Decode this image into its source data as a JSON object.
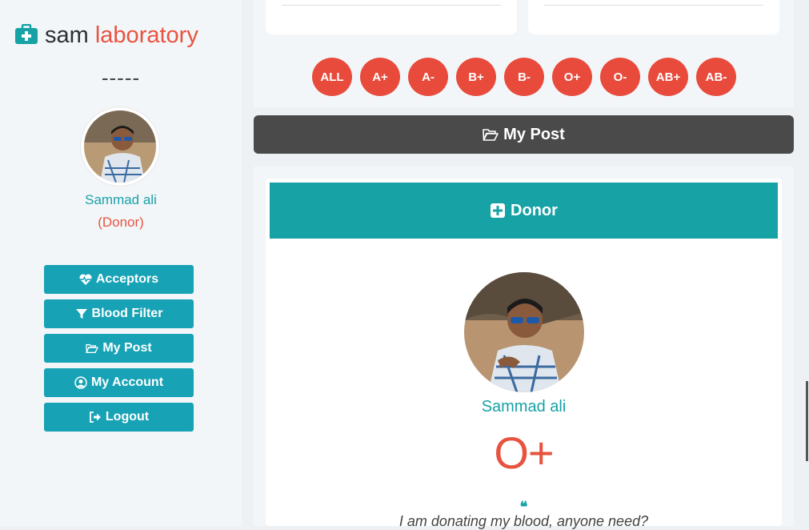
{
  "brand": {
    "word1": "sam",
    "word2": "laboratory",
    "icon": "medkit-icon"
  },
  "sidebar": {
    "separator": "-----",
    "user_name": "Sammad ali",
    "user_role": "(Donor)",
    "menu": [
      {
        "label": "Acceptors",
        "icon": "heartbeat-icon"
      },
      {
        "label": "Blood Filter",
        "icon": "filter-icon"
      },
      {
        "label": "My Post",
        "icon": "folder-open-icon"
      },
      {
        "label": "My Account",
        "icon": "user-circle-icon"
      },
      {
        "label": "Logout",
        "icon": "sign-out-icon"
      }
    ]
  },
  "filters": [
    "ALL",
    "A+",
    "A-",
    "B+",
    "B-",
    "O+",
    "O-",
    "AB+",
    "AB-"
  ],
  "my_post_bar": {
    "label": "My Post",
    "icon": "folder-open-icon"
  },
  "post": {
    "header": "Donor",
    "header_icon": "plus-square-icon",
    "name": "Sammad ali",
    "blood_group": "O+",
    "quote_icon": "quote-left-icon",
    "message": "I am donating my blood, anyone need?"
  },
  "colors": {
    "teal": "#17a2a6",
    "red": "#e84b3c",
    "dark": "#4a4a4a"
  }
}
